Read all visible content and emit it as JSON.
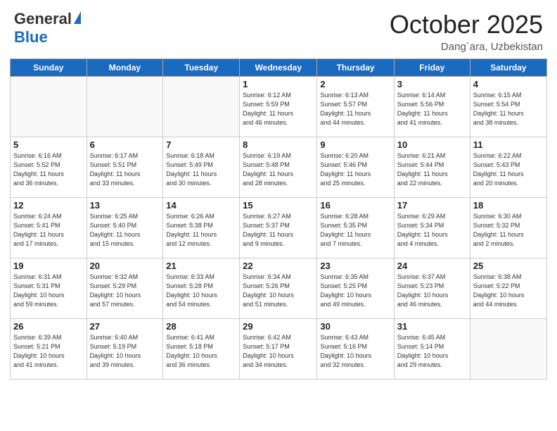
{
  "header": {
    "logo_general": "General",
    "logo_blue": "Blue",
    "month_title": "October 2025",
    "location": "Dang`ara, Uzbekistan"
  },
  "weekdays": [
    "Sunday",
    "Monday",
    "Tuesday",
    "Wednesday",
    "Thursday",
    "Friday",
    "Saturday"
  ],
  "weeks": [
    [
      {
        "day": "",
        "info": ""
      },
      {
        "day": "",
        "info": ""
      },
      {
        "day": "",
        "info": ""
      },
      {
        "day": "1",
        "info": "Sunrise: 6:12 AM\nSunset: 5:59 PM\nDaylight: 11 hours\nand 46 minutes."
      },
      {
        "day": "2",
        "info": "Sunrise: 6:13 AM\nSunset: 5:57 PM\nDaylight: 11 hours\nand 44 minutes."
      },
      {
        "day": "3",
        "info": "Sunrise: 6:14 AM\nSunset: 5:56 PM\nDaylight: 11 hours\nand 41 minutes."
      },
      {
        "day": "4",
        "info": "Sunrise: 6:15 AM\nSunset: 5:54 PM\nDaylight: 11 hours\nand 38 minutes."
      }
    ],
    [
      {
        "day": "5",
        "info": "Sunrise: 6:16 AM\nSunset: 5:52 PM\nDaylight: 11 hours\nand 36 minutes."
      },
      {
        "day": "6",
        "info": "Sunrise: 6:17 AM\nSunset: 5:51 PM\nDaylight: 11 hours\nand 33 minutes."
      },
      {
        "day": "7",
        "info": "Sunrise: 6:18 AM\nSunset: 5:49 PM\nDaylight: 11 hours\nand 30 minutes."
      },
      {
        "day": "8",
        "info": "Sunrise: 6:19 AM\nSunset: 5:48 PM\nDaylight: 11 hours\nand 28 minutes."
      },
      {
        "day": "9",
        "info": "Sunrise: 6:20 AM\nSunset: 5:46 PM\nDaylight: 11 hours\nand 25 minutes."
      },
      {
        "day": "10",
        "info": "Sunrise: 6:21 AM\nSunset: 5:44 PM\nDaylight: 11 hours\nand 22 minutes."
      },
      {
        "day": "11",
        "info": "Sunrise: 6:22 AM\nSunset: 5:43 PM\nDaylight: 11 hours\nand 20 minutes."
      }
    ],
    [
      {
        "day": "12",
        "info": "Sunrise: 6:24 AM\nSunset: 5:41 PM\nDaylight: 11 hours\nand 17 minutes."
      },
      {
        "day": "13",
        "info": "Sunrise: 6:25 AM\nSunset: 5:40 PM\nDaylight: 11 hours\nand 15 minutes."
      },
      {
        "day": "14",
        "info": "Sunrise: 6:26 AM\nSunset: 5:38 PM\nDaylight: 11 hours\nand 12 minutes."
      },
      {
        "day": "15",
        "info": "Sunrise: 6:27 AM\nSunset: 5:37 PM\nDaylight: 11 hours\nand 9 minutes."
      },
      {
        "day": "16",
        "info": "Sunrise: 6:28 AM\nSunset: 5:35 PM\nDaylight: 11 hours\nand 7 minutes."
      },
      {
        "day": "17",
        "info": "Sunrise: 6:29 AM\nSunset: 5:34 PM\nDaylight: 11 hours\nand 4 minutes."
      },
      {
        "day": "18",
        "info": "Sunrise: 6:30 AM\nSunset: 5:32 PM\nDaylight: 11 hours\nand 2 minutes."
      }
    ],
    [
      {
        "day": "19",
        "info": "Sunrise: 6:31 AM\nSunset: 5:31 PM\nDaylight: 10 hours\nand 59 minutes."
      },
      {
        "day": "20",
        "info": "Sunrise: 6:32 AM\nSunset: 5:29 PM\nDaylight: 10 hours\nand 57 minutes."
      },
      {
        "day": "21",
        "info": "Sunrise: 6:33 AM\nSunset: 5:28 PM\nDaylight: 10 hours\nand 54 minutes."
      },
      {
        "day": "22",
        "info": "Sunrise: 6:34 AM\nSunset: 5:26 PM\nDaylight: 10 hours\nand 51 minutes."
      },
      {
        "day": "23",
        "info": "Sunrise: 6:35 AM\nSunset: 5:25 PM\nDaylight: 10 hours\nand 49 minutes."
      },
      {
        "day": "24",
        "info": "Sunrise: 6:37 AM\nSunset: 5:23 PM\nDaylight: 10 hours\nand 46 minutes."
      },
      {
        "day": "25",
        "info": "Sunrise: 6:38 AM\nSunset: 5:22 PM\nDaylight: 10 hours\nand 44 minutes."
      }
    ],
    [
      {
        "day": "26",
        "info": "Sunrise: 6:39 AM\nSunset: 5:21 PM\nDaylight: 10 hours\nand 41 minutes."
      },
      {
        "day": "27",
        "info": "Sunrise: 6:40 AM\nSunset: 5:19 PM\nDaylight: 10 hours\nand 39 minutes."
      },
      {
        "day": "28",
        "info": "Sunrise: 6:41 AM\nSunset: 5:18 PM\nDaylight: 10 hours\nand 36 minutes."
      },
      {
        "day": "29",
        "info": "Sunrise: 6:42 AM\nSunset: 5:17 PM\nDaylight: 10 hours\nand 34 minutes."
      },
      {
        "day": "30",
        "info": "Sunrise: 6:43 AM\nSunset: 5:16 PM\nDaylight: 10 hours\nand 32 minutes."
      },
      {
        "day": "31",
        "info": "Sunrise: 6:45 AM\nSunset: 5:14 PM\nDaylight: 10 hours\nand 29 minutes."
      },
      {
        "day": "",
        "info": ""
      }
    ]
  ]
}
